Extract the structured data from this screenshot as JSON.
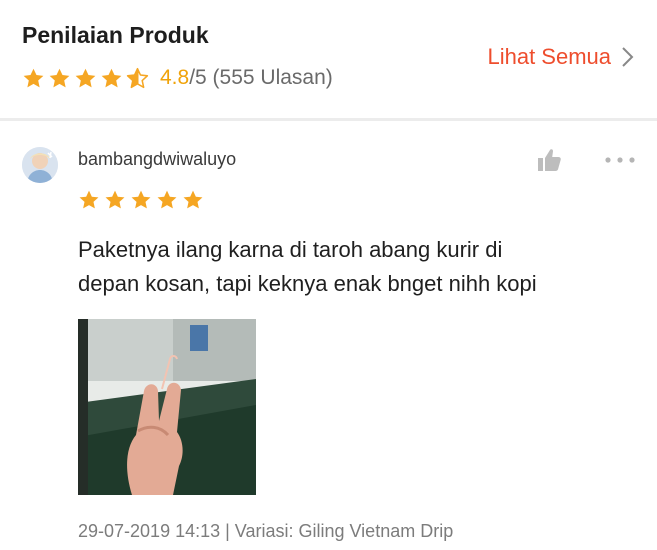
{
  "header": {
    "title": "Penilaian Produk",
    "rating_score": "4.8",
    "rating_suffix": "/5 (555 Ulasan)",
    "average_rating": 4.8,
    "see_all_label": "Lihat Semua",
    "star_color": "#f5a623",
    "accent_color": "#ee4d2d"
  },
  "review": {
    "username": "bambangdwiwaluyo",
    "stars": 5,
    "comment_lines": [
      "Paketnya ilang karna di taroh abang kurir di",
      "depan kosan, tapi keknya enak bnget nihh kopi"
    ],
    "meta": "29-07-2019 14:13 | Variasi: Giling Vietnam Drip",
    "icons": {
      "like": "thumbs-up-icon",
      "more": "more-options-icon"
    }
  }
}
